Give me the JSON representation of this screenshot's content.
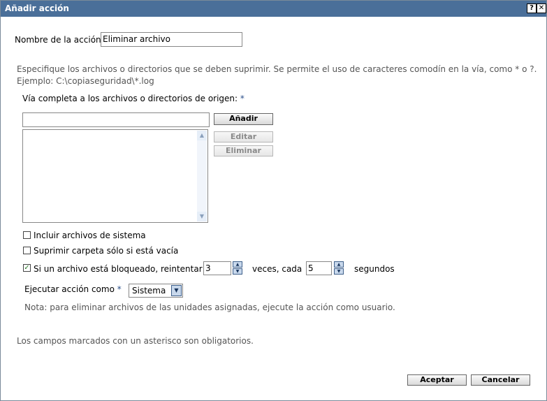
{
  "window": {
    "title": "Añadir acción",
    "help_glyph": "?",
    "close_glyph": "✕"
  },
  "form": {
    "action_name_label": "Nombre de la acción",
    "action_name_value": "Eliminar archivo",
    "description_line1": "Especifique los archivos o directorios que se deben suprimir. Se permite el uso de caracteres comodín en la vía, como * o ?.",
    "description_line2": "Ejemplo: C:\\copiaseguridad\\*.log",
    "source_path_label": "Vía completa a los archivos o directorios de origen:",
    "required_marker": "*",
    "path_input_value": "",
    "buttons": {
      "add": "Añadir",
      "edit": "Editar",
      "delete": "Eliminar"
    },
    "checkboxes": [
      {
        "label": "Incluir archivos de sistema",
        "checked": false
      },
      {
        "label": "Suprimir carpeta sólo si está vacía",
        "checked": false
      },
      {
        "label": "Si un archivo está bloqueado, reintentar",
        "checked": true
      }
    ],
    "retry_count": "3",
    "retry_times_label": "veces, cada",
    "retry_interval": "5",
    "retry_seconds_label": "segundos",
    "run_as_label": "Ejecutar acción como",
    "run_as_value": "Sistema",
    "note": "Nota: para eliminar archivos de las unidades asignadas, ejecute la acción como usuario.",
    "required_note": "Los campos marcados con un asterisco son obligatorios."
  },
  "footer": {
    "accept": "Aceptar",
    "cancel": "Cancelar"
  },
  "icons": {
    "check": "✓",
    "scroll_up": "▲",
    "scroll_down": "▼",
    "spin_up": "▲",
    "spin_down": "▼",
    "dropdown": "▼"
  }
}
